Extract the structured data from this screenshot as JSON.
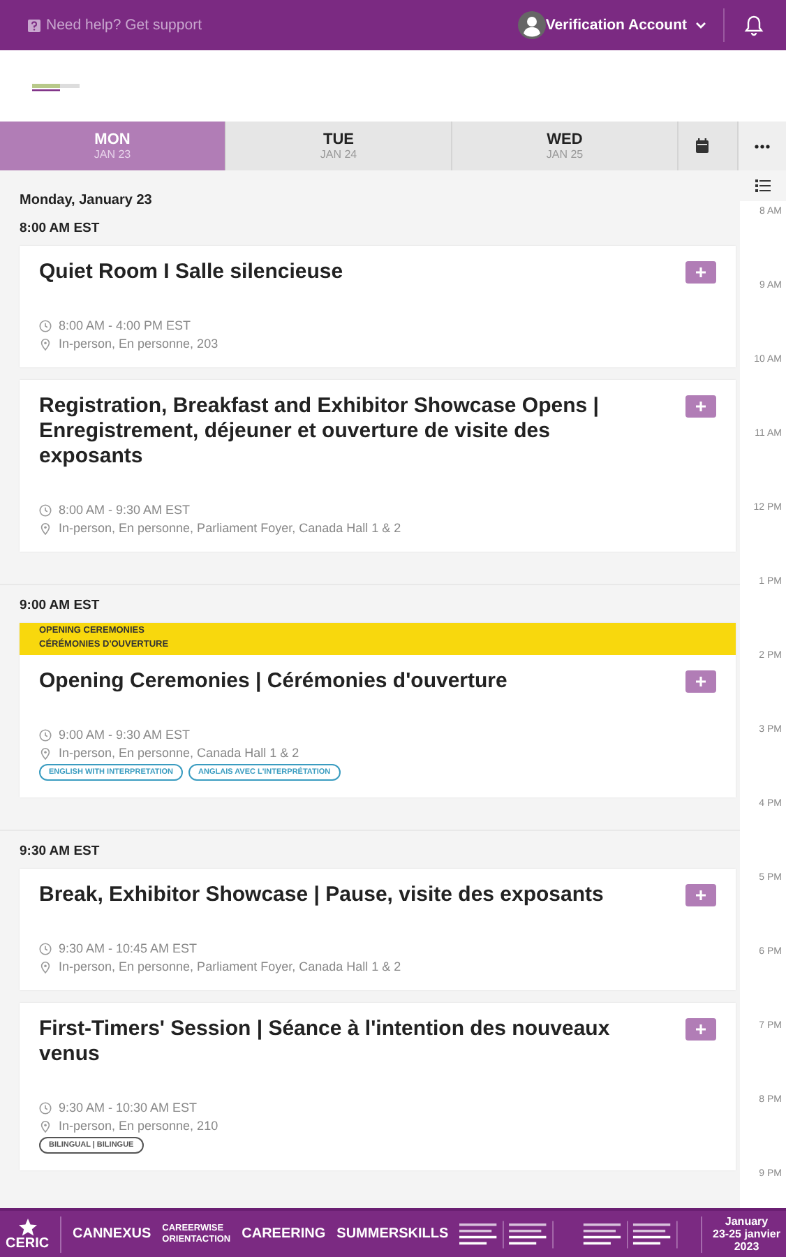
{
  "top_bar": {
    "help": "Need help? Get support",
    "account": "Verification Account"
  },
  "day_tabs": [
    {
      "day": "MON",
      "date": "JAN 23",
      "selected": true
    },
    {
      "day": "TUE",
      "date": "JAN 24",
      "selected": false
    },
    {
      "day": "WED",
      "date": "JAN 25",
      "selected": false
    }
  ],
  "date_heading": "Monday, January 23",
  "time_groups": [
    {
      "time": "8:00 AM EST",
      "sessions": [
        {
          "title": "Quiet Room I Salle silencieuse",
          "when": "8:00 AM - 4:00 PM EST",
          "where": "In-person, En personne, 203"
        },
        {
          "title": "Registration, Breakfast and Exhibitor Showcase Opens | Enregistrement, déjeuner et ouverture de visite des exposants",
          "when": "8:00 AM - 9:30 AM EST",
          "where": "In-person, En personne, Parliament Foyer, Canada Hall 1 & 2"
        }
      ]
    },
    {
      "time": "9:00 AM EST",
      "sessions": [
        {
          "track": [
            "OPENING CEREMONIES",
            "CÉRÉMONIES D'OUVERTURE"
          ],
          "title": "Opening Ceremonies | Cérémonies d'ouverture",
          "when": "9:00 AM - 9:30 AM EST",
          "where": "In-person, En personne, Canada Hall 1 & 2",
          "tags": [
            {
              "label": "ENGLISH WITH INTERPRETATION",
              "color": "#3a9cc0"
            },
            {
              "label": "ANGLAIS AVEC L'INTERPRÉTATION",
              "color": "#3a9cc0"
            }
          ]
        }
      ]
    },
    {
      "time": "9:30 AM EST",
      "sessions": [
        {
          "title": "Break, Exhibitor Showcase | Pause, visite des exposants",
          "when": "9:30 AM - 10:45 AM EST",
          "where": "In-person, En personne, Parliament Foyer, Canada Hall 1 & 2"
        },
        {
          "title": "First-Timers' Session | Séance à l'intention des nouveaux venus",
          "when": "9:30 AM - 10:30 AM EST",
          "where": "In-person, En personne, 210",
          "tags": [
            {
              "label": "BILINGUAL | BILINGUE",
              "color": "#555555"
            }
          ]
        }
      ]
    }
  ],
  "hour_rail": [
    "8 AM",
    "9 AM",
    "10 AM",
    "11 AM",
    "12 PM",
    "1 PM",
    "2 PM",
    "3 PM",
    "4 PM",
    "5 PM",
    "6 PM",
    "7 PM",
    "8 PM",
    "9 PM"
  ],
  "footer_banner": {
    "ceric": "CERIC",
    "brands": [
      {
        "kind": "single",
        "lines": [
          "CANNEXUS"
        ]
      },
      {
        "kind": "stacked",
        "lines": [
          "CAREERWISE",
          "ORIENTACTION"
        ]
      },
      {
        "kind": "single",
        "lines": [
          "CAREERING"
        ]
      },
      {
        "kind": "single",
        "lines": [
          "SUMMERSKILLS"
        ]
      }
    ],
    "dates": [
      "January",
      "23-25 janvier",
      "2023"
    ]
  }
}
